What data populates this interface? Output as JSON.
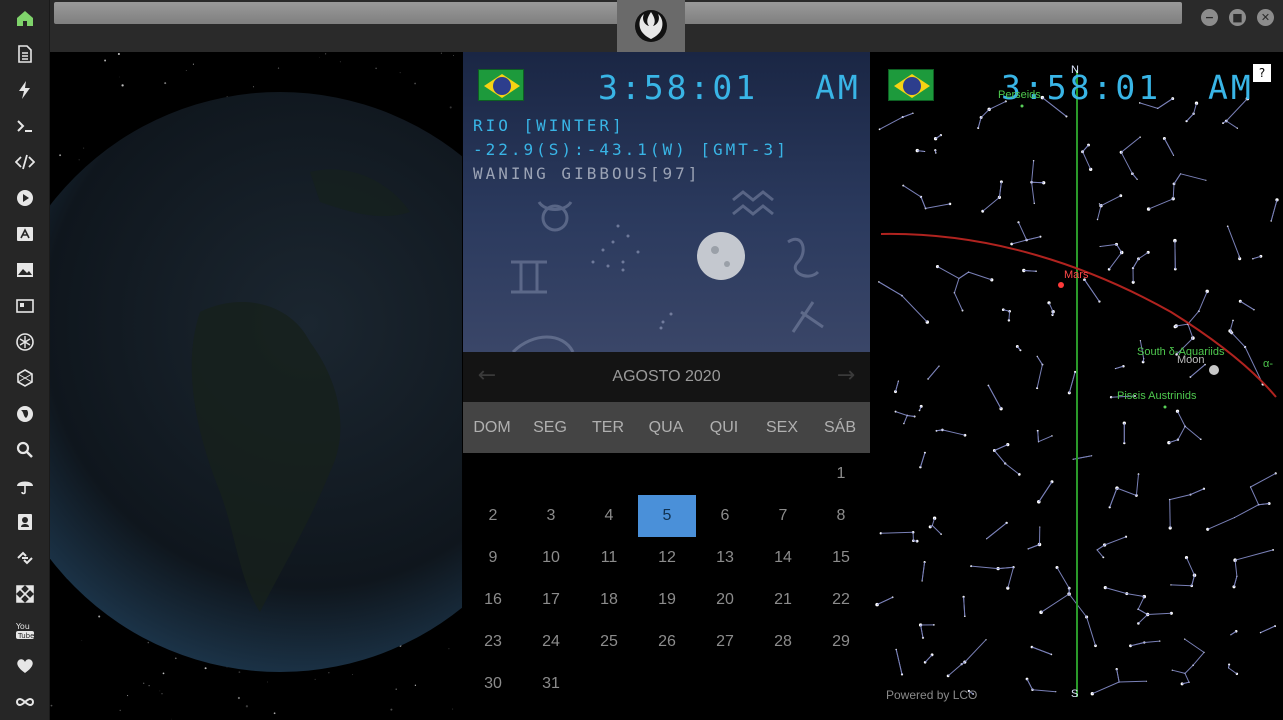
{
  "window": {
    "minimize_glyph": "−",
    "maximize_glyph": "■",
    "close_glyph": "✕"
  },
  "sidebar": {
    "items": [
      {
        "icon": "home-icon",
        "active": true
      },
      {
        "icon": "document-icon"
      },
      {
        "icon": "lightning-icon"
      },
      {
        "icon": "terminal-icon"
      },
      {
        "icon": "code-icon"
      },
      {
        "icon": "play-icon"
      },
      {
        "icon": "translate-icon"
      },
      {
        "icon": "image-icon"
      },
      {
        "icon": "news-icon"
      },
      {
        "icon": "rebel-emblem-icon"
      },
      {
        "icon": "hexagon-icon"
      },
      {
        "icon": "globe-icon"
      },
      {
        "icon": "search-icon"
      },
      {
        "icon": "umbrella-icon"
      },
      {
        "icon": "contacts-icon"
      },
      {
        "icon": "link-icon"
      },
      {
        "icon": "expand-icon"
      },
      {
        "icon": "youtube-icon"
      },
      {
        "icon": "heart-icon"
      },
      {
        "icon": "infinity-icon"
      }
    ],
    "active_color": "#7fd36b"
  },
  "clock": {
    "time": "3:58:01",
    "ampm": "AM",
    "location_line": "RIO [WINTER]",
    "coords_line": "-22.9(S):-43.1(W) [GMT-3]",
    "moon_line": "WANING GIBBOUS[97]"
  },
  "calendar": {
    "title": "AGOSTO 2020",
    "weekdays": [
      "DOM",
      "SEG",
      "TER",
      "QUA",
      "QUI",
      "SEX",
      "SÁB"
    ],
    "today": "5",
    "weeks": [
      [
        "",
        "",
        "",
        "",
        "",
        "",
        "1"
      ],
      [
        "2",
        "3",
        "4",
        "5",
        "6",
        "7",
        "8"
      ],
      [
        "9",
        "10",
        "11",
        "12",
        "13",
        "14",
        "15"
      ],
      [
        "16",
        "17",
        "18",
        "19",
        "20",
        "21",
        "22"
      ],
      [
        "23",
        "24",
        "25",
        "26",
        "27",
        "28",
        "29"
      ],
      [
        "30",
        "31",
        "",
        "",
        "",
        "",
        ""
      ]
    ]
  },
  "sky": {
    "time": "3:58:01",
    "ampm": "AM",
    "north": "N",
    "south": "S",
    "help": "?",
    "labels": {
      "perseids": "Perseids",
      "mars": "Mars",
      "aquariids": "South δ-Aquariids",
      "moon": "Moon",
      "piscis": "Piscis Austrinids",
      "alpha": "α-"
    },
    "powered_by": "Powered by  LCO"
  }
}
